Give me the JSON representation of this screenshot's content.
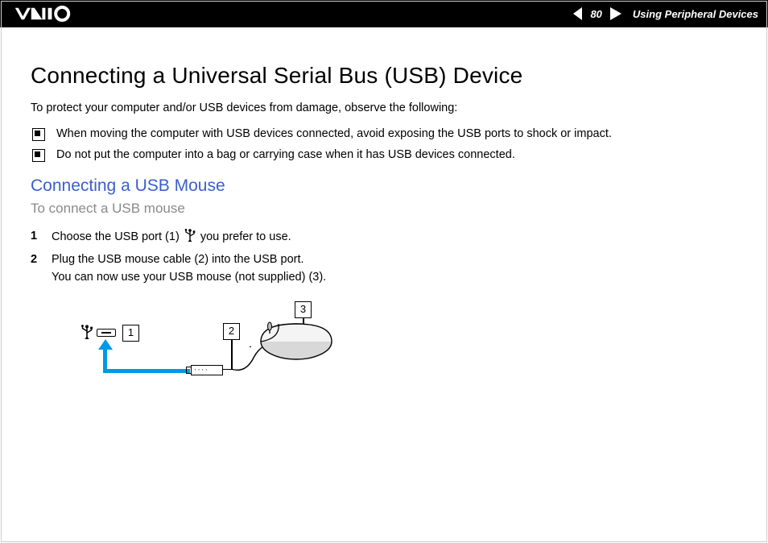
{
  "header": {
    "page_number": "80",
    "section": "Using Peripheral Devices"
  },
  "title": "Connecting a Universal Serial Bus (USB) Device",
  "intro": "To protect your computer and/or USB devices from damage, observe the following:",
  "bullets": [
    "When moving the computer with USB devices connected, avoid exposing the USB ports to shock or impact.",
    "Do not put the computer into a bag or carrying case when it has USB devices connected."
  ],
  "subtitle": "Connecting a USB Mouse",
  "subinstruction": "To connect a USB mouse",
  "steps": [
    {
      "num": "1",
      "before": "Choose the USB port (1) ",
      "after": " you prefer to use."
    },
    {
      "num": "2",
      "before": "Plug the USB mouse cable (2) into the USB port.",
      "line2": "You can now use your USB mouse (not supplied) (3)."
    }
  ],
  "callouts": {
    "c1": "1",
    "c2": "2",
    "c3": "3"
  }
}
